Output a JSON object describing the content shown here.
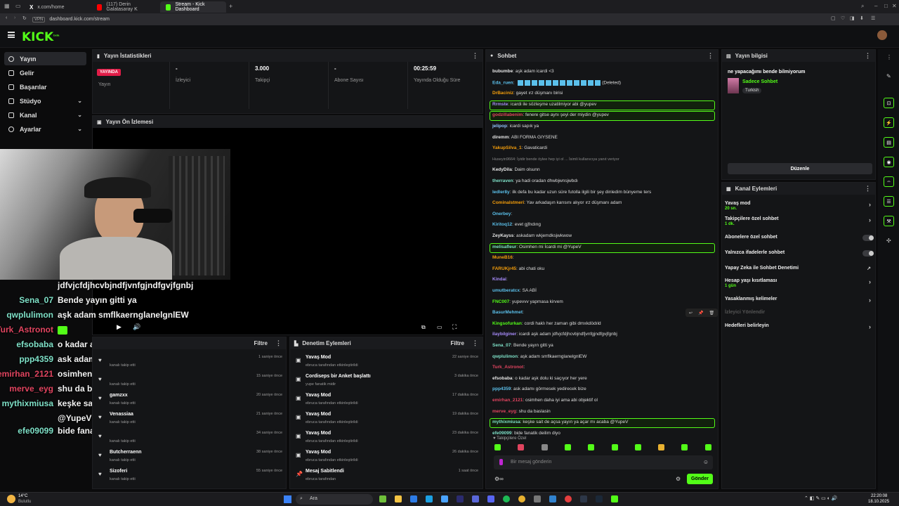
{
  "browser": {
    "tabs": [
      {
        "label": "x.com/home"
      },
      {
        "label": "(117) Derin Galatasaray K"
      },
      {
        "label": "Stream - Kick Dashboard"
      }
    ],
    "url": "dashboard.kick.com/stream",
    "vpn_label": "VPN"
  },
  "app": {
    "logo": "KICK",
    "logo_badge": "beta"
  },
  "sidebar": {
    "items": [
      {
        "label": "Yayın"
      },
      {
        "label": "Gelir"
      },
      {
        "label": "Başarılar"
      },
      {
        "label": "Stüdyo"
      },
      {
        "label": "Kanal"
      },
      {
        "label": "Ayarlar"
      }
    ]
  },
  "stats": {
    "title": "Yayın İstatistikleri",
    "live_badge": "YAYINDA",
    "cells": [
      {
        "value": "",
        "label": "Yayın"
      },
      {
        "value": "-",
        "label": "İzleyici"
      },
      {
        "value": "3.000",
        "label": "Takipçi"
      },
      {
        "value": "-",
        "label": "Abone Sayısı"
      },
      {
        "value": "00:25:59",
        "label": "Yayında Olduğu Süre"
      }
    ]
  },
  "preview": {
    "title": "Yayın Ön İzlemesi"
  },
  "overlay_chat": [
    {
      "user": "",
      "text": "jdfvjcfdjhcvbjndfjvnfgjndfgvjfgnbj",
      "color": "#ffffff"
    },
    {
      "user": "Sena_07",
      "text": "Bende yayın gitti ya",
      "color": "#7ee0c7"
    },
    {
      "user": "qwplulimon",
      "text": "aşk adam smflkaernglanelgnlEW",
      "color": "#7ee0c7"
    },
    {
      "user": "Turk_Astronot",
      "text": "",
      "color": "#e0445f"
    },
    {
      "user": "efsobaba",
      "text": "o kadar aşk dolu ki saçıyor her yere",
      "color": "#7ee0c7"
    },
    {
      "user": "ppp4359",
      "text": "ask adamı görmesek yedirecek bize",
      "color": "#7ee0c7"
    },
    {
      "user": "emirhan_2121",
      "text": "osimhen daha iyi ama abi objektif ol",
      "color": "#e0445f"
    },
    {
      "user": "merve_eyg",
      "text": "shu da baslasin",
      "color": "#e0445f"
    },
    {
      "user": "mythixmiusa",
      "text": "keşke sait de açsa yayın ya açar mı acaba",
      "color": "#7ee0c7"
    },
    {
      "user": "",
      "text": "@YupeV",
      "color": "#ffffff"
    },
    {
      "user": "efe09099",
      "text": "bide fanatik deilim diyo",
      "color": "#7ee0c7"
    }
  ],
  "activity": {
    "filter_label": "Filtre",
    "rows": [
      {
        "name": "",
        "sub": "kanalı takip etti",
        "time": "1 saniye önce"
      },
      {
        "name": "",
        "sub": "kanalı takip etti",
        "time": "15 saniye önce"
      },
      {
        "name": "gamzxx",
        "sub": "kanalı takip etti",
        "time": "20 saniye önce"
      },
      {
        "name": "Venassiaa",
        "sub": "kanalı takip etti",
        "time": "21 saniye önce"
      },
      {
        "name": "",
        "sub": "kanalı takip etti",
        "time": "34 saniye önce"
      },
      {
        "name": "Butcherraenn",
        "sub": "kanalı takip etti",
        "time": "38 saniye önce"
      },
      {
        "name": "Sizoferi",
        "sub": "kanalı takip etti",
        "time": "55 saniye önce"
      }
    ]
  },
  "moderation": {
    "title": "Denetim Eylemleri",
    "filter_label": "Filtre",
    "rows": [
      {
        "title": "Yavaş Mod",
        "sub": "ebruca tarafından etkinleştirildi",
        "time": "22 saniye önce"
      },
      {
        "title": "Cordiseps bir Anket başlattı",
        "sub": "yupe fanatik midir",
        "time": "3 dakika önce"
      },
      {
        "title": "Yavaş Mod",
        "sub": "ebruca tarafından etkinleştirildi",
        "time": "17 dakika önce"
      },
      {
        "title": "Yavaş Mod",
        "sub": "ebruca tarafından etkinleştirildi",
        "time": "19 dakika önce"
      },
      {
        "title": "Yavaş Mod",
        "sub": "ebruca tarafından etkinleştirildi",
        "time": "23 dakika önce"
      },
      {
        "title": "Yavaş Mod",
        "sub": "ebruca tarafından etkinleştirildi",
        "time": "26 dakika önce"
      },
      {
        "title": "Mesaj Sabitlendi",
        "sub": "ebruca tarafından",
        "time": "1 saat önce"
      }
    ]
  },
  "chat": {
    "title": "Sohbet",
    "messages": [
      {
        "user": "bubumbe",
        "text": "aşk adam icardi <3",
        "color": "#e6e6e6"
      },
      {
        "user": "Eda_ruen",
        "text": "(Deleted)",
        "color": "#5bc0eb"
      },
      {
        "user": "DrBaciniz",
        "text": "gayet ırz düşmanı birisi",
        "color": "#f59e0b"
      },
      {
        "user": "Rrmste",
        "text": "icardi ile sözleşme uzatilmiyor abi @yupev",
        "color": "#a78bfa"
      },
      {
        "user": "godzillabenim",
        "text": "fenere gitse aynı şeyi der miydin @yupev",
        "color": "#e0445f"
      },
      {
        "user": "jelipop",
        "text": "icardi sapık ya",
        "color": "#93c5fd"
      },
      {
        "user": "diremm",
        "text": "ABI FORMA GIYSENE",
        "color": "#e6e6e6"
      },
      {
        "user": "YakupSilva_1",
        "text": "Gavaticardi",
        "color": "#f59e0b"
      },
      {
        "user": "",
        "text": "Huseyin9664: İyidir bende öylee hep iyi ol ... İsimli kullanıcıya yanıt veriyor",
        "color": "#888888"
      },
      {
        "user": "KedyDila",
        "text": "Daim olsunn",
        "color": "#e6e6e6"
      },
      {
        "user": "therraven",
        "text": "ya hadi oradan dhwbjwnsjwbdı",
        "color": "#7ee0c7"
      },
      {
        "user": "ledler8y",
        "text": "ilk defa bu kadar uzun süre futolla ilgili bir şey dinledim bünyeme ters",
        "color": "#5bc0eb"
      },
      {
        "user": "Cominalstmeri",
        "text": "Yav arkadaşın karısını alıyor ırz düşmanı adam",
        "color": "#f59e0b"
      },
      {
        "user": "Onerbey",
        "text": "",
        "color": "#5bc0eb"
      },
      {
        "user": "Kiritoq12",
        "text": "evet gjfndıng",
        "color": "#5bc0eb"
      },
      {
        "user": "ZeyKayss",
        "text": "askadam wkjemdksjwkwow",
        "color": "#e6e6e6"
      },
      {
        "user": "melisafleur",
        "text": "Osimhen mi İcardi mi @YupeV",
        "color": "#7ee0c7"
      },
      {
        "user": "MuneB16",
        "text": "",
        "color": "#f59e0b"
      },
      {
        "user": "FARUKjr45",
        "text": "abi chati oku",
        "color": "#f59e0b"
      },
      {
        "user": "Kindai",
        "text": "",
        "color": "#a78bfa"
      },
      {
        "user": "umutberatcx",
        "text": "SA ABİ",
        "color": "#5bc0eb"
      },
      {
        "user": "FNC007",
        "text": "yupevvv yapmasa kirvem",
        "color": "#53fc18"
      },
      {
        "user": "BasurMehmet",
        "text": "",
        "color": "#5bc0eb"
      },
      {
        "user": "Kingsofurkan",
        "text": "cordi haklı her zaman gibi dmxkdödıld",
        "color": "#53fc18"
      },
      {
        "user": "ilaybilginer",
        "text": "icardi aşk adam jdfvjcfdjhcvbjndfjvnfgjndfgvjfgnbj",
        "color": "#a78bfa"
      },
      {
        "user": "Sena_07",
        "text": "Bende yayın gitti ya",
        "color": "#7ee0c7"
      },
      {
        "user": "qwplulimon",
        "text": "aşk adam smflkaernglanelgnlEW",
        "color": "#7ee0c7"
      },
      {
        "user": "Turk_Astronot",
        "text": "",
        "color": "#e0445f"
      },
      {
        "user": "efsobaba",
        "text": "o kadar aşk dolu ki saçıyor her yere",
        "color": "#e6e6e6"
      },
      {
        "user": "ppp4359",
        "text": "ask adamı görmesek yedirecek bize",
        "color": "#5bc0eb"
      },
      {
        "user": "emirhan_2121",
        "text": "osimhen daha iyi ama abi objektif ol",
        "color": "#e0445f"
      },
      {
        "user": "merve_eyg",
        "text": "shu da baslasin",
        "color": "#e0445f"
      },
      {
        "user": "mythixmiusa",
        "text": "keşke sait de açsa yayın ya açar mı acaba @YupeV",
        "color": "#7ee0c7"
      },
      {
        "user": "efe09099",
        "text": "bide fanatik deilim diyo",
        "color": "#7ee0c7"
      }
    ],
    "followers_only": "Takipçilere Özel",
    "input_placeholder": "Bir mesaj gönderin",
    "send_label": "Gönder"
  },
  "stream_info": {
    "title": "Yayın bilgisi",
    "stream_title": "ne yapacağımı bende bilmiyorum",
    "category": "Sadece Sohbet",
    "tag": "Turkish",
    "edit_label": "Düzenle"
  },
  "channel_actions": {
    "title": "Kanal Eylemleri",
    "items": [
      {
        "label": "Yavaş mod",
        "sub": "20 sn."
      },
      {
        "label": "Takipçilere özel sohbet",
        "sub": "1 dk."
      },
      {
        "label": "Abonelere özel sohbet",
        "sub": ""
      },
      {
        "label": "Yalnızca ifadelerle sohbet",
        "sub": ""
      },
      {
        "label": "Yapay Zeka ile Sohbet Denetimi",
        "sub": ""
      },
      {
        "label": "Hesap yaşı kısıtlaması",
        "sub": "1 gün"
      },
      {
        "label": "Yasaklanmış kelimeler",
        "sub": ""
      },
      {
        "label": "İzleyici Yönlendir",
        "sub": ""
      },
      {
        "label": "Hedefleri belirleyin",
        "sub": ""
      }
    ]
  },
  "taskbar": {
    "weather_temp": "14°C",
    "weather_desc": "Bulutlu",
    "search": "Ara",
    "time": "22:20:08",
    "date": "18.10.2025"
  },
  "colors": {
    "accent": "#53fc18",
    "live": "#e11d48"
  }
}
